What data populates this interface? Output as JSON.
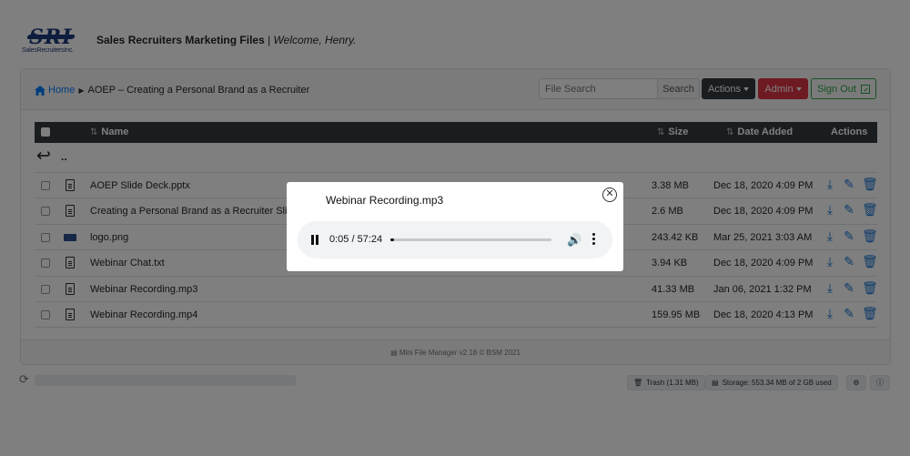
{
  "brand": {
    "logo_text": "SRI",
    "logo_subtext": "SalesRecruitersInc.",
    "app_title": "Sales Recruiters Marketing Files",
    "separator": " | ",
    "welcome": "Welcome, Henry."
  },
  "breadcrumb": {
    "home_label": "Home",
    "current": "AOEP – Creating a Personal Brand as a Recruiter"
  },
  "toolbar": {
    "search_placeholder": "File Search",
    "search_label": "Search",
    "actions_label": "Actions",
    "admin_label": "Admin",
    "signout_label": "Sign Out"
  },
  "table": {
    "columns": {
      "name": "Name",
      "size": "Size",
      "date": "Date Added",
      "actions": "Actions"
    },
    "parent_dir": "..",
    "rows": [
      {
        "name": "AOEP Slide Deck.pptx",
        "size": "3.38 MB",
        "date": "Dec 18, 2020 4:09 PM",
        "icon": "file-pptx-icon"
      },
      {
        "name": "Creating a Personal Brand as a Recruiter Sli",
        "size": "2.6 MB",
        "date": "Dec 18, 2020 4:09 PM",
        "icon": "file-pdf-icon"
      },
      {
        "name": "logo.png",
        "size": "243.42 KB",
        "date": "Mar 25, 2021 3:03 AM",
        "icon": "image-thumbnail-icon"
      },
      {
        "name": "Webinar Chat.txt",
        "size": "3.94 KB",
        "date": "Dec 18, 2020 4:09 PM",
        "icon": "file-text-icon"
      },
      {
        "name": "Webinar Recording.mp3",
        "size": "41.33 MB",
        "date": "Jan 06, 2021 1:32 PM",
        "icon": "file-audio-icon"
      },
      {
        "name": "Webinar Recording.mp4",
        "size": "159.95 MB",
        "date": "Dec 18, 2020 4:13 PM",
        "icon": "file-video-icon"
      }
    ]
  },
  "footer": {
    "text": "Mini File Manager v2.18 © BSM 2021"
  },
  "statusbar": {
    "trash": "Trash (1.31 MB)",
    "storage": "Storage: 553.34 MB of 2 GB used"
  },
  "modal": {
    "title": "Webinar Recording.mp3",
    "time": "0:05 / 57:24",
    "progress_fraction": 0.0015
  },
  "colors": {
    "link": "#007bff",
    "dark": "#343a40",
    "danger": "#dc3545",
    "success": "#28a745",
    "action_icon": "#1976d2"
  }
}
